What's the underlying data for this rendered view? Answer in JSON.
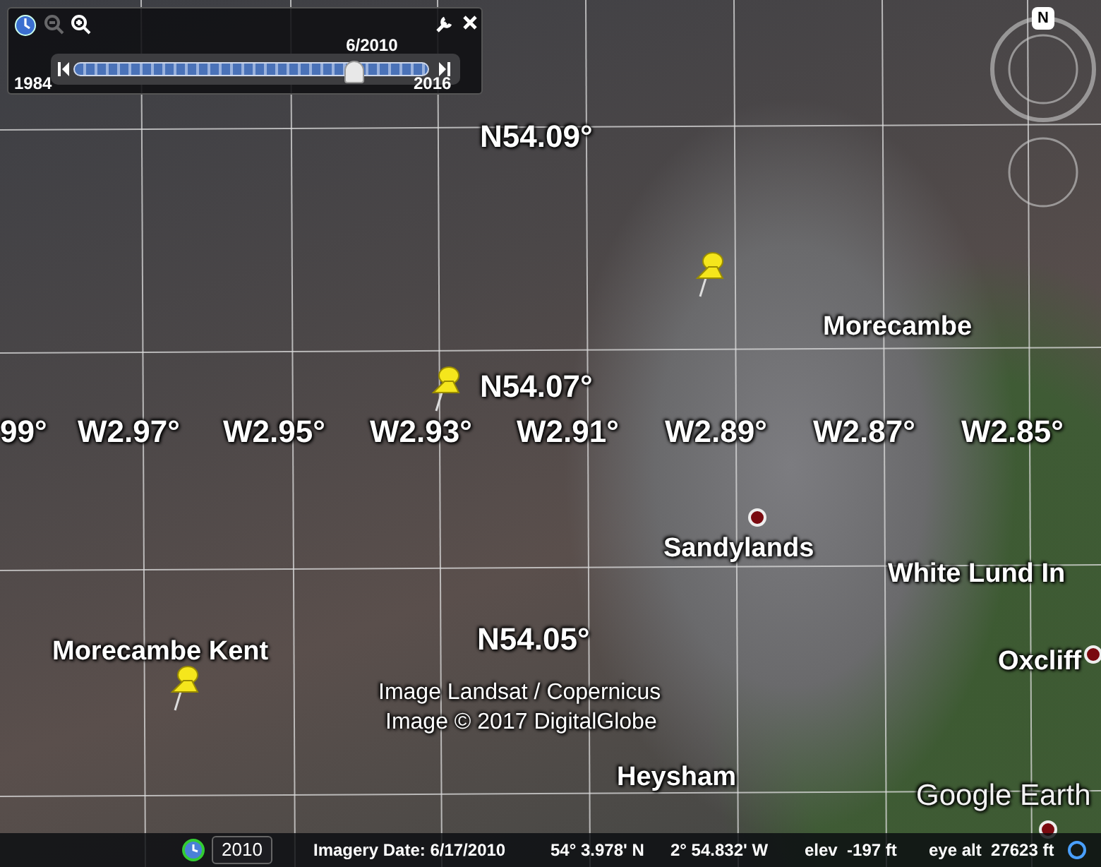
{
  "time_slider": {
    "zoom_out_disabled": true,
    "date_label": "6/2010",
    "start_year": "1984",
    "end_year": "2016",
    "level": 0.79
  },
  "compass": {
    "north_label": "N"
  },
  "map": {
    "latitude_labels": [
      "N54.09°",
      "N54.07°",
      "N54.05°"
    ],
    "longitude_labels": [
      "99°",
      "W2.97°",
      "W2.95°",
      "W2.93°",
      "W2.91°",
      "W2.89°",
      "W2.87°",
      "W2.85°"
    ],
    "places": [
      {
        "name": "Morecambe",
        "dot": false
      },
      {
        "name": "Sandylands",
        "dot": true
      },
      {
        "name": "White Lund In",
        "dot": false
      },
      {
        "name": "Oxcliff",
        "dot": true
      },
      {
        "name": "Heysham",
        "dot": false
      },
      {
        "name": "Morecambe Kent",
        "dot": false
      }
    ],
    "attribution": [
      "Image Landsat / Copernicus",
      "Image © 2017 DigitalGlobe"
    ],
    "logo": "Google Earth"
  },
  "status_bar": {
    "year": "2010",
    "imagery_date": "Imagery Date: 6/17/2010",
    "latitude": "54° 3.978' N",
    "longitude": "2° 54.832' W",
    "elevation": "elev  -197 ft",
    "eye_altitude": "eye alt  27623 ft"
  }
}
